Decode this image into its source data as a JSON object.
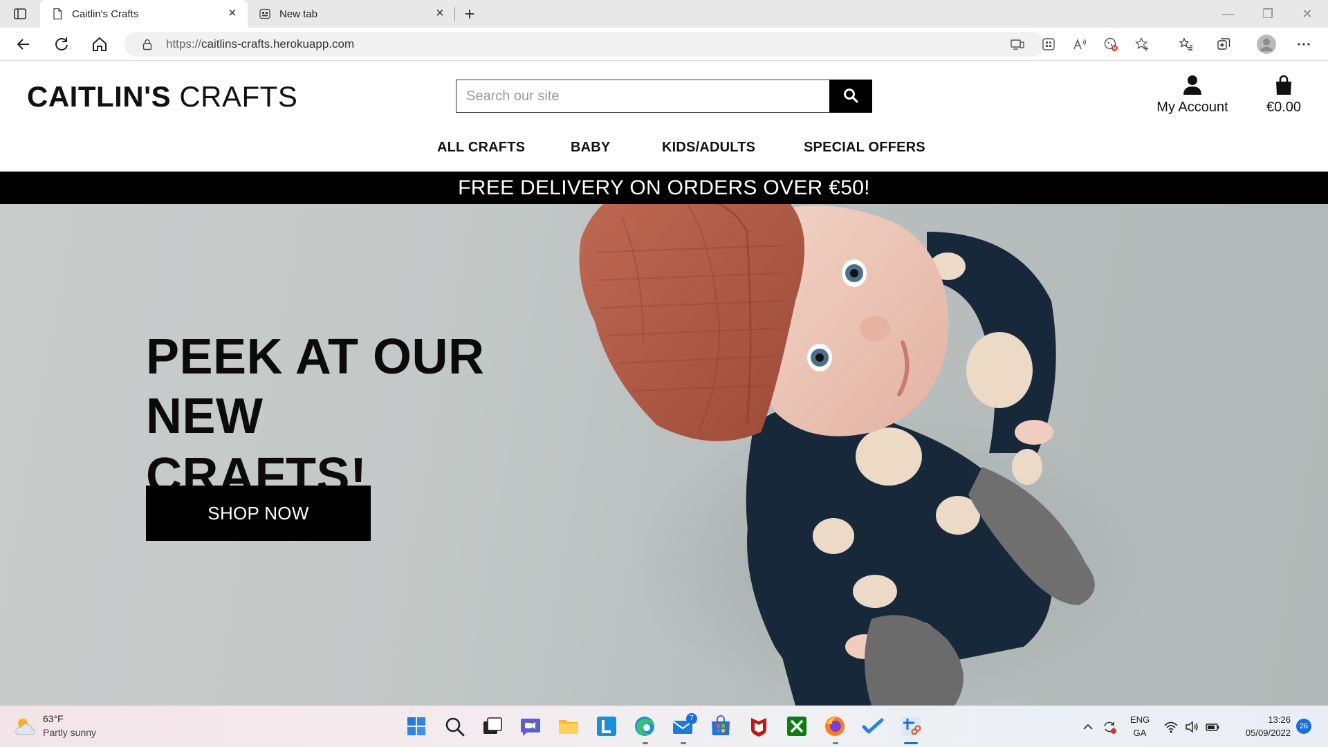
{
  "browser": {
    "tabs": [
      {
        "title": "Caitlin's Crafts",
        "active": true
      },
      {
        "title": "New tab",
        "active": false
      }
    ],
    "url_host": "caitlins-crafts.herokuapp.com",
    "url_prefix": "https://"
  },
  "site": {
    "logo_bold": "CAITLIN'S",
    "logo_light": "CRAFTS",
    "search_placeholder": "Search our site",
    "account_label": "My Account",
    "bag_total": "€0.00",
    "nav": [
      "ALL CRAFTS",
      "BABY",
      "KIDS/ADULTS",
      "SPECIAL OFFERS"
    ],
    "promo": "FREE DELIVERY ON ORDERS OVER €50!",
    "hero_title_line1": "PEEK AT OUR NEW",
    "hero_title_line2": "CRAFTS!",
    "hero_cta": "SHOP NOW"
  },
  "taskbar": {
    "weather_temp": "63°F",
    "weather_condition": "Partly sunny",
    "mail_badge": "7",
    "language_line1": "ENG",
    "language_line2": "GA",
    "time": "13:26",
    "date": "05/09/2022",
    "notification_count": "26"
  },
  "colors": {
    "accent": "#1a6fd8",
    "header_bg": "#ffffff",
    "promo_bg": "#000000",
    "cta_bg": "#000000",
    "hat": "#b45a45",
    "suit": "#17283a"
  }
}
